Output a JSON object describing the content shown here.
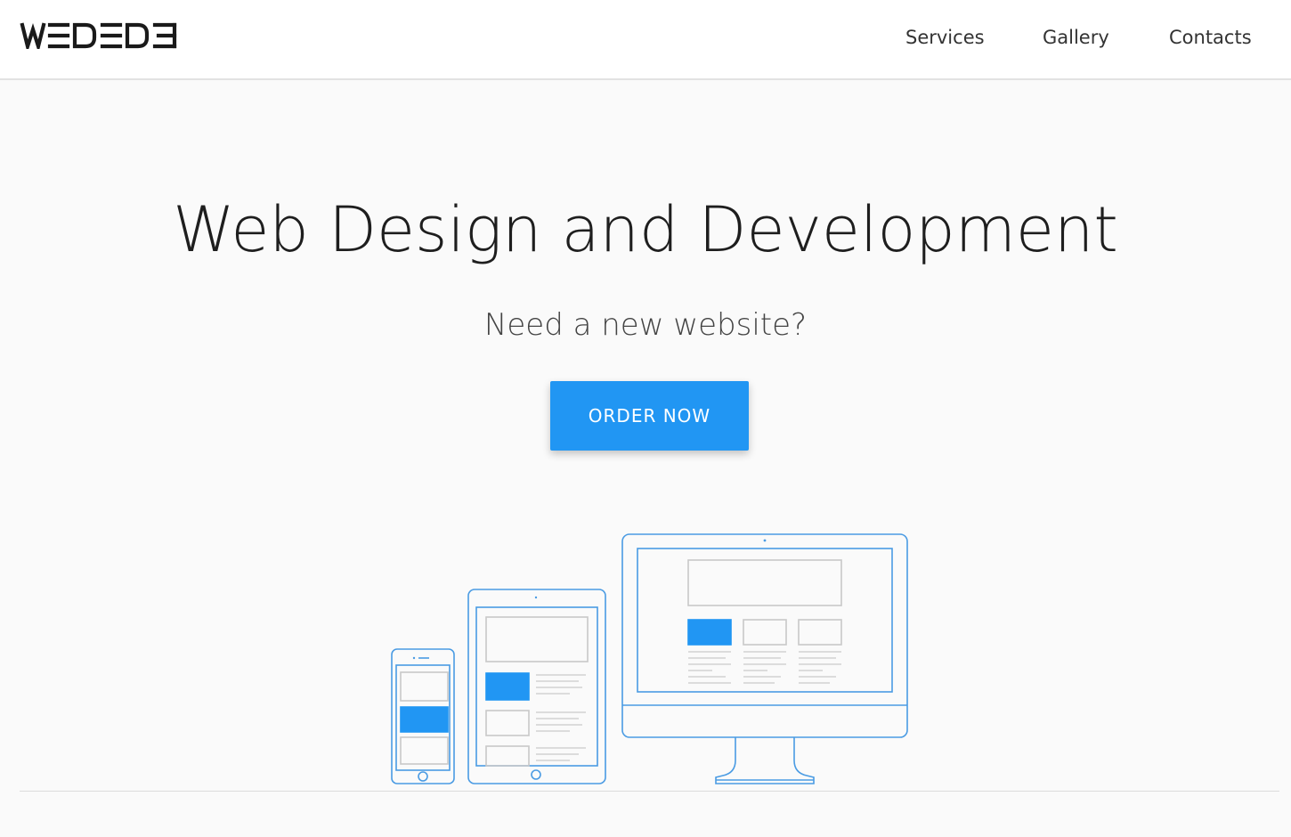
{
  "brand": {
    "logo_text": "WEDEDE",
    "logo_icon": "wedede-logo"
  },
  "nav": {
    "items": [
      {
        "label": "Services"
      },
      {
        "label": "Gallery"
      },
      {
        "label": "Contacts"
      }
    ]
  },
  "hero": {
    "title": "Web Design and Development",
    "subtitle": "Need a new website?",
    "cta_label": "ORDER NOW"
  },
  "illustration": {
    "icon": "responsive-devices-illustration",
    "devices": [
      "phone-icon",
      "tablet-icon",
      "desktop-monitor-icon"
    ]
  },
  "colors": {
    "accent": "#2196f3",
    "outline": "#4a9be3",
    "background": "#fafafa",
    "header_bg": "#ffffff"
  }
}
